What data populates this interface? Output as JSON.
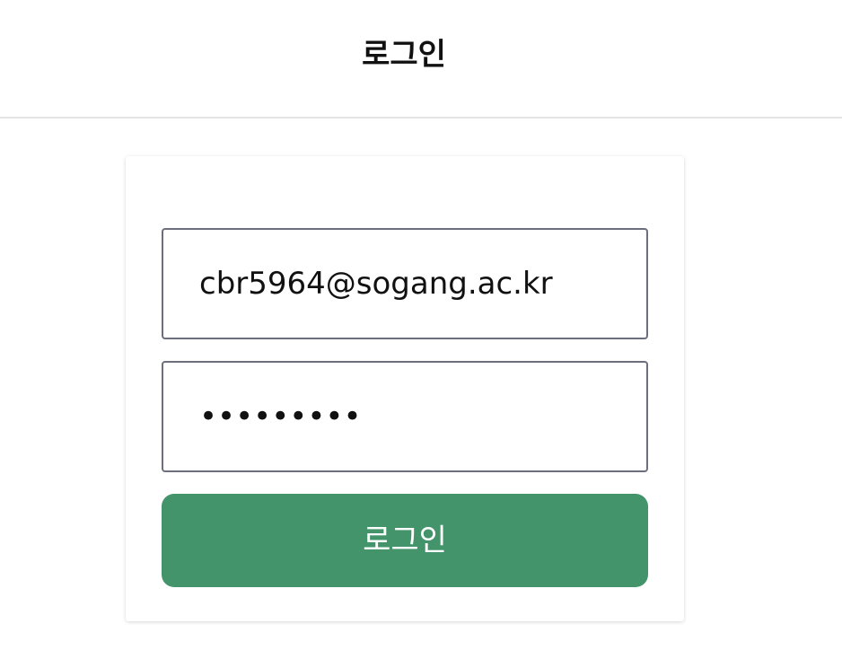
{
  "header": {
    "title": "로그인"
  },
  "login_form": {
    "email_value": "cbr5964@sogang.ac.kr",
    "password_mask": "•••••••••",
    "submit_label": "로그인"
  },
  "colors": {
    "button_bg": "#43946a",
    "button_text": "#ffffff",
    "input_border": "#6c6e7b",
    "divider": "#e4e4e4"
  }
}
